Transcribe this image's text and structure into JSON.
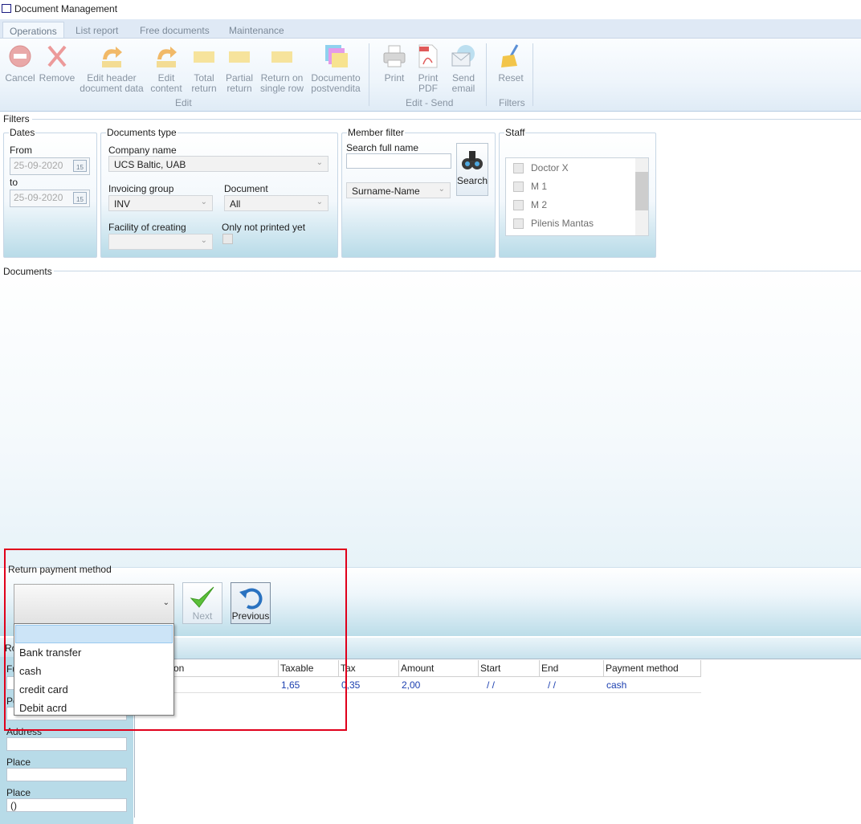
{
  "window": {
    "title": "Document Management"
  },
  "tabs": [
    "Operations",
    "List report",
    "Free documents",
    "Maintenance"
  ],
  "ribbon": {
    "cancel": "Cancel",
    "remove": "Remove",
    "edit_header": [
      "Edit header",
      "document data"
    ],
    "edit_content": [
      "Edit",
      "content"
    ],
    "total_return": [
      "Total",
      "return"
    ],
    "partial_return": [
      "Partial",
      "return"
    ],
    "return_single_row": [
      "Return on",
      "single row"
    ],
    "documento_postvendita": [
      "Documento",
      "postvendita"
    ],
    "group_edit": "Edit",
    "print": "Print",
    "print_pdf": [
      "Print",
      "PDF"
    ],
    "send_email": [
      "Send",
      "email"
    ],
    "group_edit_send": "Edit - Send",
    "reset": "Reset",
    "group_filters": "Filters"
  },
  "filters": {
    "section_title": "Filters",
    "dates": {
      "legend": "Dates",
      "from_label": "From",
      "from_value": "25-09-2020",
      "to_label": "to",
      "to_value": "25-09-2020",
      "cal_day": "15"
    },
    "documents_type": {
      "legend": "Documents type",
      "company_label": "Company name",
      "company_value": "UCS Baltic, UAB",
      "invoicing_label": "Invoicing group",
      "invoicing_value": "INV",
      "document_label": "Document",
      "document_value": "All",
      "facility_label": "Facility of creating",
      "facility_value": "",
      "not_printed_label": "Only not printed yet"
    },
    "member_filter": {
      "legend": "Member filter",
      "search_label": "Search full name",
      "search_value": "",
      "order_value": "Surname-Name",
      "search_button": "Search"
    },
    "staff": {
      "legend": "Staff",
      "items": [
        "Doctor X",
        "M 1",
        "M 2",
        "Pilenis Mantas"
      ]
    }
  },
  "documents": {
    "section_title": "Documents"
  },
  "return_payment": {
    "label": "Return payment method",
    "selected": "",
    "next_button": "Next",
    "previous_button": "Previous",
    "options": [
      "",
      "Bank transfer",
      "cash",
      "credit card",
      "Debit acrd"
    ]
  },
  "left_panel": {
    "section_fragment": "Ro",
    "field1_fragment": "Fu",
    "field2_fragment": "Pe",
    "address_label": "Address",
    "address_value": "",
    "place1_label": "Place",
    "place1_value": "",
    "place2_label": "Place",
    "place2_value": "()"
  },
  "grid": {
    "headers": [
      "on",
      "Taxable",
      "Tax",
      "Amount",
      "Start",
      "End",
      "Payment method"
    ],
    "row": [
      "1,65",
      "0,35",
      "2,00",
      "/ /",
      "/ /",
      "cash"
    ]
  },
  "colors": {
    "highlight_border": "#e0001b",
    "link_blue": "#1b3fb0",
    "selected_option": "#cce4f7"
  }
}
